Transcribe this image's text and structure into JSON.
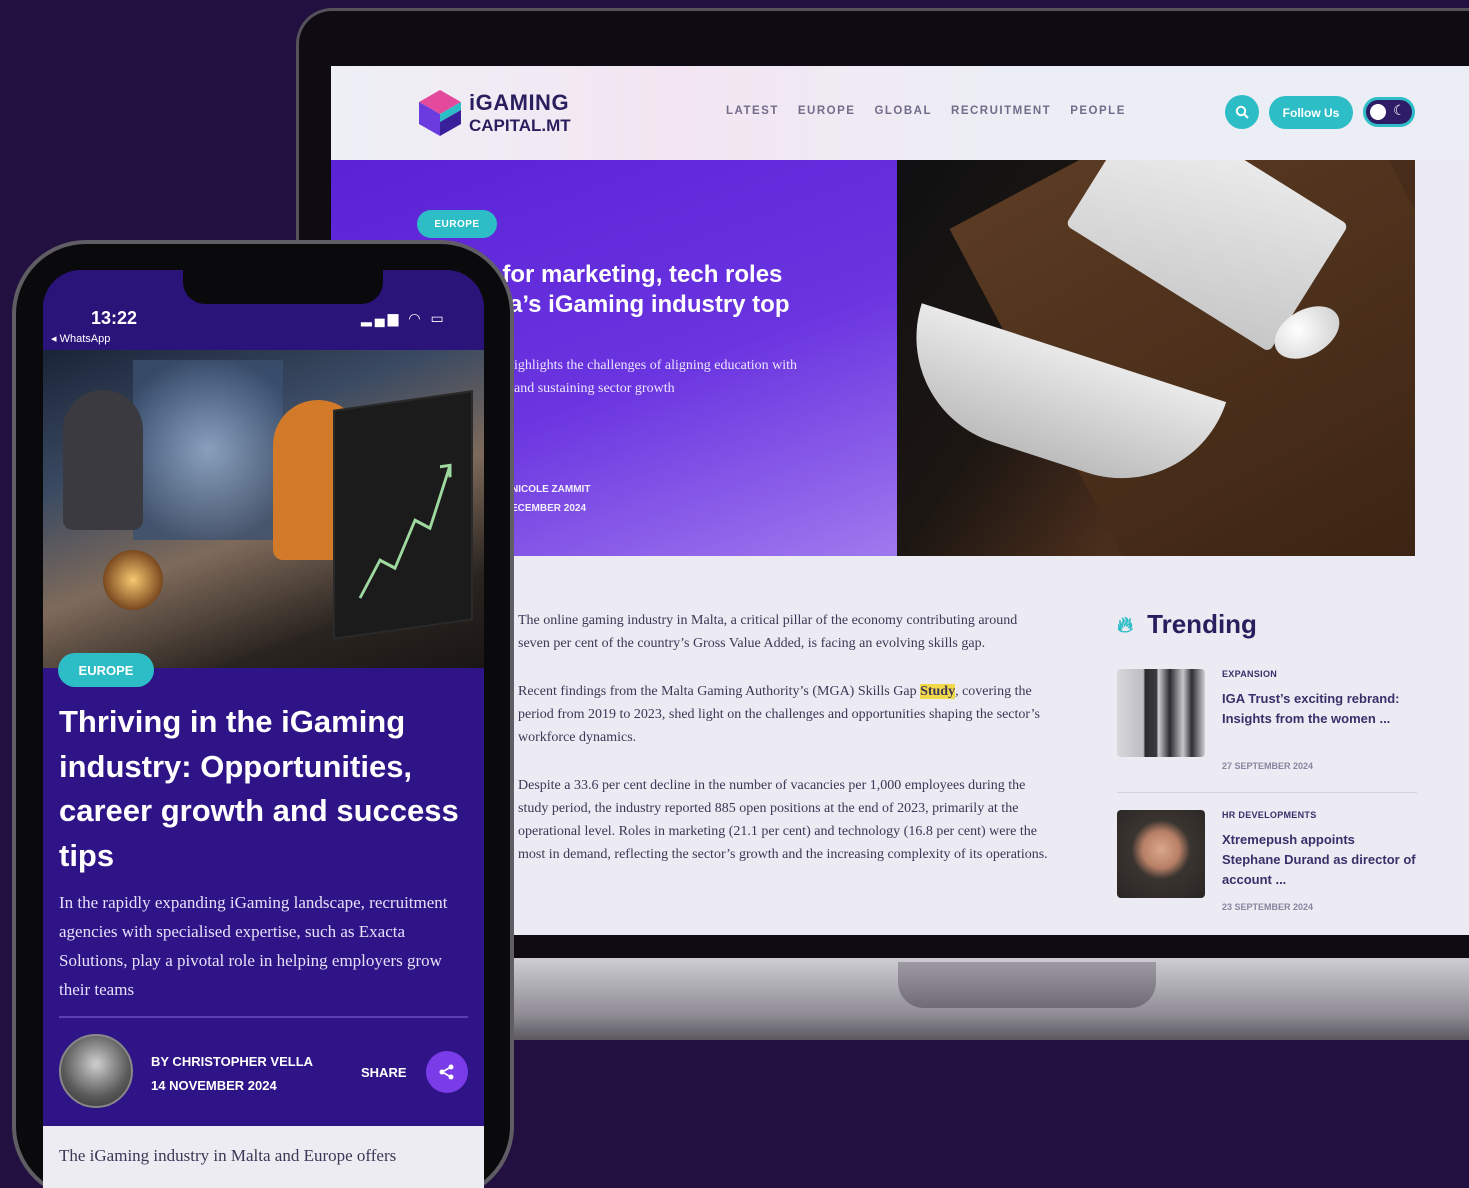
{
  "colors": {
    "background": "#211040",
    "accent": "#2dbdc6",
    "brand_purple": "#5b22d6",
    "text_dark": "#2a1f5e"
  },
  "desktop": {
    "logo": {
      "line1": "iGAMING",
      "line2": "CAPITAL.MT"
    },
    "nav": [
      "LATEST",
      "EUROPE",
      "GLOBAL",
      "RECRUITMENT",
      "PEOPLE"
    ],
    "follow_label": "Follow Us",
    "hero": {
      "tag": "EUROPE",
      "title": "d for marketing, tech roles\nalta’s iGaming industry top",
      "subtitle": "ighlights the challenges of aligning education with\n and sustaining sector growth",
      "author": "NICOLE ZAMMIT",
      "date": "ECEMBER 2024"
    },
    "article": {
      "p1": "The online gaming industry in Malta, a critical pillar of the economy contributing around seven per cent of the country’s Gross Value Added, is facing an evolving skills gap.",
      "p2_before": "Recent findings from the Malta Gaming Authority’s (MGA) Skills Gap ",
      "p2_link": "Study",
      "p2_after": ", covering the period from 2019 to 2023, shed light on the challenges and opportunities shaping the sector’s workforce dynamics.",
      "p3": "Despite a 33.6 per cent decline in the number of vacancies per 1,000 employees during the study period, the industry reported 885 open positions at the end of 2023, primarily at the operational level. Roles in marketing (21.1 per cent) and technology (16.8 per cent) were the most in demand, reflecting the sector’s growth and the increasing complexity of its operations."
    },
    "trending": {
      "title": "Trending",
      "items": [
        {
          "category": "EXPANSION",
          "headline": "IGA Trust’s exciting rebrand: Insights from the women ...",
          "date": "27 SEPTEMBER 2024"
        },
        {
          "category": "HR DEVELOPMENTS",
          "headline": "Xtremepush appoints Stephane Durand as director of account ...",
          "date": "23 SEPTEMBER 2024"
        }
      ]
    }
  },
  "mobile": {
    "time": "13:22",
    "back_label": "◂ WhatsApp",
    "tag": "EUROPE",
    "title": "Thriving in the iGaming industry: Opportunities, career growth and success tips",
    "subtitle": "In the rapidly expanding iGaming landscape, recruitment agencies with specialised expertise, such as Exacta Solutions, play a pivotal role in helping employers grow their teams",
    "author": "BY CHRISTOPHER VELLA",
    "date": "14 NOVEMBER 2024",
    "share_label": "SHARE",
    "body_start": "The iGaming industry in Malta and Europe offers"
  }
}
